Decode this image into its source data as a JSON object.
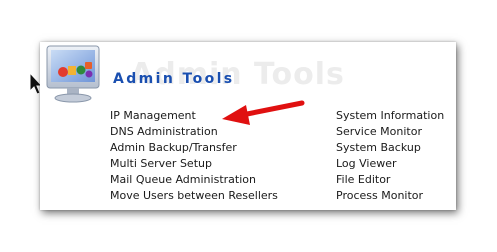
{
  "section": {
    "title": "Admin Tools",
    "title_watermark": "Admin Tools"
  },
  "tools": {
    "left": [
      "IP Management",
      "DNS Administration",
      "Admin Backup/Transfer",
      "Multi Server Setup",
      "Mail Queue Administration",
      "Move Users between Resellers"
    ],
    "right": [
      "System Information",
      "Service Monitor",
      "System Backup",
      "Log Viewer",
      "File Editor",
      "Process Monitor"
    ]
  },
  "colors": {
    "title": "#1a4fb0",
    "annotation_arrow": "#e01010",
    "link_text": "#1a1a1a"
  },
  "icons": {
    "section_icon": "monitor-with-apps-icon",
    "cursor": "mouse-pointer-icon",
    "annotation": "red-arrow-icon"
  }
}
